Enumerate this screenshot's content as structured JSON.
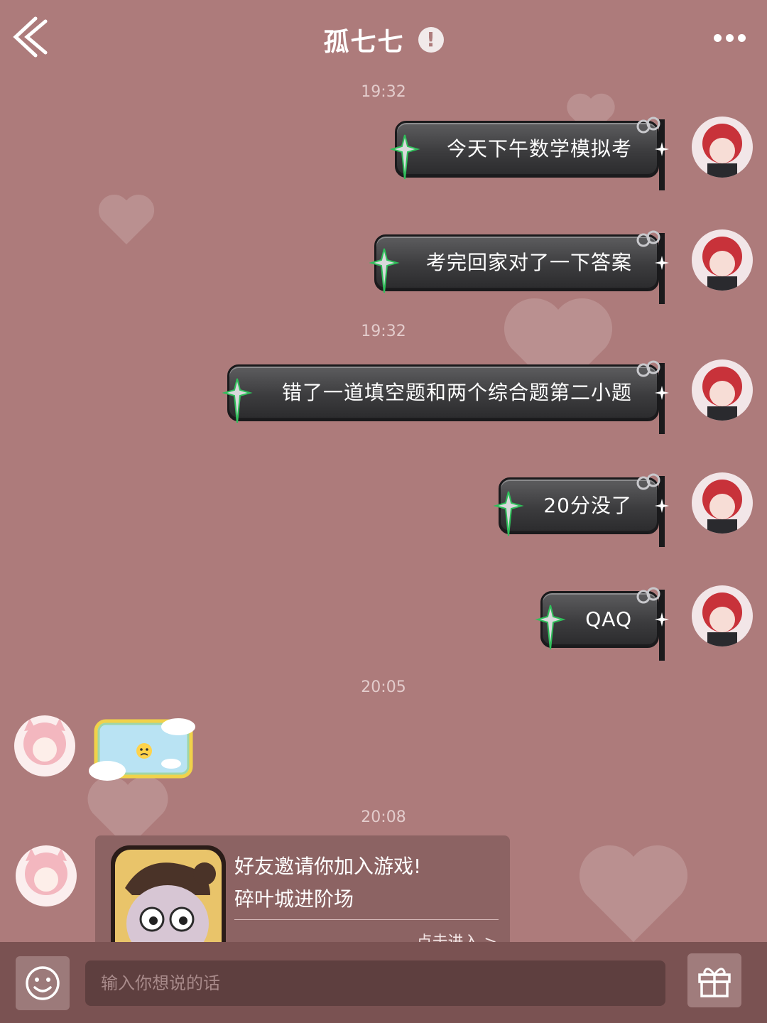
{
  "header": {
    "title": "孤七七",
    "alert_icon": "exclamation-icon",
    "back_icon": "double-chevron-left-icon",
    "more_icon": "ellipsis-icon"
  },
  "messages": [
    {
      "type": "timestamp",
      "text": "19:32"
    },
    {
      "type": "outgoing",
      "text": "今天下午数学模拟考"
    },
    {
      "type": "outgoing",
      "text": "考完回家对了一下答案"
    },
    {
      "type": "timestamp",
      "text": "19:32"
    },
    {
      "type": "outgoing",
      "text": "错了一道填空题和两个综合题第二小题"
    },
    {
      "type": "outgoing",
      "text": "20分没了"
    },
    {
      "type": "outgoing",
      "text": "QAQ"
    },
    {
      "type": "timestamp",
      "text": "20:05"
    },
    {
      "type": "incoming-sticker",
      "sticker": "worried-face-cloud-sticker"
    },
    {
      "type": "timestamp",
      "text": "20:08"
    },
    {
      "type": "incoming-card",
      "title_line1": "好友邀请你加入游戏!",
      "title_line2": "碎叶城进阶场",
      "action": "点击进入 >"
    }
  ],
  "input": {
    "placeholder": "输入你想说的话",
    "emoji_icon": "smiley-icon",
    "gift_icon": "gift-icon"
  },
  "colors": {
    "background": "#ad7b7b",
    "bubble": "#3f3f41",
    "bottom_bar": "#7a5252",
    "input_bg": "#5e3f3f",
    "card_bg": "#8c6363"
  }
}
